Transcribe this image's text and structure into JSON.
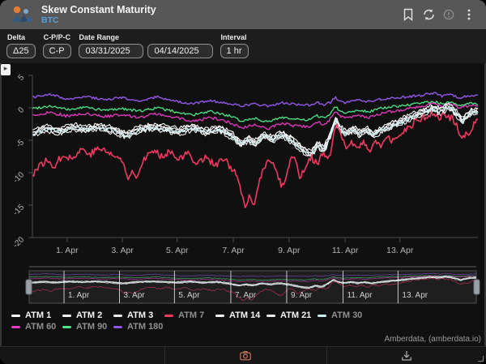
{
  "header": {
    "title": "Skew Constant Maturity",
    "subtitle": "BTC",
    "icons": [
      "bookmark",
      "refresh",
      "info",
      "kebab-menu"
    ]
  },
  "controls": {
    "delta": {
      "label": "Delta",
      "value": "Δ25"
    },
    "cppc": {
      "label": "C-P/P-C",
      "value": "C-P"
    },
    "date_range": {
      "label": "Date Range",
      "start": "03/31/2025",
      "end": "04/14/2025"
    },
    "interval": {
      "label": "Interval",
      "value": "1 hr"
    }
  },
  "footer": {
    "attribution": "Amberdata, (amberdata.io)",
    "toolbar_icons": [
      "camera",
      "download"
    ]
  },
  "chart_data": {
    "type": "line",
    "title": "Skew Constant Maturity",
    "xlabel": "",
    "ylabel": "",
    "ylim": [
      -20,
      5
    ],
    "grid": false,
    "legend_position": "bottom",
    "y_ticks": [
      {
        "label": "5",
        "value": 5
      },
      {
        "label": "0",
        "value": 0
      },
      {
        "label": "-5",
        "value": -5
      },
      {
        "label": "-10",
        "value": -10
      },
      {
        "label": "-15",
        "value": -15
      },
      {
        "label": "-20",
        "value": -20
      }
    ],
    "x_ticks": [
      {
        "label": "1. Apr",
        "frac": 0.078
      },
      {
        "label": "3. Apr",
        "frac": 0.202
      },
      {
        "label": "5. Apr",
        "frac": 0.325
      },
      {
        "label": "7. Apr",
        "frac": 0.451
      },
      {
        "label": "9. Apr",
        "frac": 0.576
      },
      {
        "label": "11. Apr",
        "frac": 0.702
      },
      {
        "label": "13. Apr",
        "frac": 0.825
      }
    ],
    "navigator": {
      "vmin": -17,
      "vmax": 4,
      "labels": [
        "1. Apr",
        "3. Apr",
        "5. Apr",
        "7. Apr",
        "9. Apr",
        "11. Apr",
        "13. Apr"
      ]
    },
    "draw_order": [
      "ATM 180",
      "ATM 90",
      "ATM 60",
      "ATM 21",
      "ATM 14",
      "ATM 3",
      "ATM 2",
      "ATM 1",
      "ATM 30",
      "ATM 7"
    ],
    "series": [
      {
        "name": "ATM 1",
        "color": "#ffffff",
        "dim": false,
        "width": 1.1,
        "noise": 0.28,
        "seed": 11,
        "base": "ATM 30",
        "offset": 0.55
      },
      {
        "name": "ATM 2",
        "color": "#f4f4f4",
        "dim": false,
        "width": 1.1,
        "noise": 0.3,
        "seed": 22,
        "base": "ATM 30",
        "offset": 0.3
      },
      {
        "name": "ATM 3",
        "color": "#ededed",
        "dim": false,
        "width": 1.1,
        "noise": 0.3,
        "seed": 33,
        "base": "ATM 30",
        "offset": 0.1
      },
      {
        "name": "ATM 7",
        "color": "#ef3a62",
        "dim": true,
        "width": 1.6,
        "noise": 0.55,
        "seed": 77,
        "points": [
          [
            0,
            -10.3
          ],
          [
            0.012,
            -9.2
          ],
          [
            0.03,
            -8.2
          ],
          [
            0.05,
            -8.9
          ],
          [
            0.07,
            -7.1
          ],
          [
            0.09,
            -7.9
          ],
          [
            0.11,
            -6.3
          ],
          [
            0.13,
            -7.1
          ],
          [
            0.15,
            -6.2
          ],
          [
            0.17,
            -6.9
          ],
          [
            0.19,
            -7.6
          ],
          [
            0.205,
            -8.6
          ],
          [
            0.215,
            -11.2
          ],
          [
            0.225,
            -9.4
          ],
          [
            0.235,
            -10.6
          ],
          [
            0.25,
            -7.8
          ],
          [
            0.27,
            -6.7
          ],
          [
            0.29,
            -7.4
          ],
          [
            0.31,
            -6.6
          ],
          [
            0.33,
            -7.9
          ],
          [
            0.35,
            -7
          ],
          [
            0.37,
            -8.6
          ],
          [
            0.39,
            -7.5
          ],
          [
            0.41,
            -8.9
          ],
          [
            0.43,
            -7.9
          ],
          [
            0.45,
            -9.5
          ],
          [
            0.462,
            -11
          ],
          [
            0.472,
            -14.2
          ],
          [
            0.478,
            -15.9
          ],
          [
            0.487,
            -13.2
          ],
          [
            0.497,
            -15.7
          ],
          [
            0.507,
            -11.8
          ],
          [
            0.52,
            -9
          ],
          [
            0.532,
            -8.1
          ],
          [
            0.545,
            -9.2
          ],
          [
            0.56,
            -12.4
          ],
          [
            0.572,
            -9.8
          ],
          [
            0.582,
            -7.3
          ],
          [
            0.592,
            -8.4
          ],
          [
            0.602,
            -10.9
          ],
          [
            0.612,
            -9
          ],
          [
            0.625,
            -7.5
          ],
          [
            0.64,
            -8.8
          ],
          [
            0.652,
            -7
          ],
          [
            0.665,
            -8.2
          ],
          [
            0.675,
            -4.6
          ],
          [
            0.683,
            -2.6
          ],
          [
            0.692,
            -4.3
          ],
          [
            0.703,
            -6.2
          ],
          [
            0.715,
            -4.9
          ],
          [
            0.728,
            -6.4
          ],
          [
            0.742,
            -5.3
          ],
          [
            0.756,
            -6.6
          ],
          [
            0.77,
            -5
          ],
          [
            0.784,
            -5.9
          ],
          [
            0.798,
            -4.6
          ],
          [
            0.812,
            -5.4
          ],
          [
            0.826,
            -4
          ],
          [
            0.845,
            -3
          ],
          [
            0.865,
            -1.9
          ],
          [
            0.885,
            -1.3
          ],
          [
            0.9,
            -0.9
          ],
          [
            0.912,
            -1.7
          ],
          [
            0.925,
            -1
          ],
          [
            0.94,
            -1.6
          ],
          [
            0.952,
            -2.6
          ],
          [
            0.963,
            -4.9
          ],
          [
            0.972,
            -3.9
          ],
          [
            0.981,
            -4.6
          ],
          [
            0.991,
            -2.6
          ],
          [
            1,
            -2.1
          ]
        ]
      },
      {
        "name": "ATM 14",
        "color": "#fbfbfb",
        "dim": false,
        "width": 1.1,
        "noise": 0.3,
        "seed": 44,
        "base": "ATM 30",
        "offset": -0.15
      },
      {
        "name": "ATM 21",
        "color": "#f0f0f0",
        "dim": false,
        "width": 1.1,
        "noise": 0.32,
        "seed": 55,
        "base": "ATM 30",
        "offset": -0.35
      },
      {
        "name": "ATM 30",
        "color": "#c9eef0",
        "dim": true,
        "width": 1.2,
        "noise": 0.3,
        "seed": 66,
        "points": [
          [
            0,
            -4
          ],
          [
            0.03,
            -3.2
          ],
          [
            0.06,
            -3.7
          ],
          [
            0.09,
            -3
          ],
          [
            0.12,
            -3.4
          ],
          [
            0.15,
            -3
          ],
          [
            0.18,
            -3.5
          ],
          [
            0.21,
            -4.3
          ],
          [
            0.24,
            -3.4
          ],
          [
            0.27,
            -3
          ],
          [
            0.3,
            -3.3
          ],
          [
            0.33,
            -3.7
          ],
          [
            0.36,
            -3.1
          ],
          [
            0.39,
            -3.8
          ],
          [
            0.42,
            -3.3
          ],
          [
            0.45,
            -4.5
          ],
          [
            0.468,
            -5.6
          ],
          [
            0.485,
            -4.9
          ],
          [
            0.5,
            -5.5
          ],
          [
            0.52,
            -4.3
          ],
          [
            0.54,
            -4.9
          ],
          [
            0.56,
            -4.1
          ],
          [
            0.585,
            -5.2
          ],
          [
            0.605,
            -6.4
          ],
          [
            0.625,
            -7.3
          ],
          [
            0.64,
            -5.8
          ],
          [
            0.655,
            -6.6
          ],
          [
            0.668,
            -4.4
          ],
          [
            0.68,
            -1.9
          ],
          [
            0.69,
            -3.3
          ],
          [
            0.705,
            -4
          ],
          [
            0.72,
            -3.3
          ],
          [
            0.735,
            -4.1
          ],
          [
            0.75,
            -3.5
          ],
          [
            0.765,
            -4.2
          ],
          [
            0.78,
            -3.6
          ],
          [
            0.8,
            -3
          ],
          [
            0.82,
            -2.4
          ],
          [
            0.84,
            -1.8
          ],
          [
            0.86,
            -1.2
          ],
          [
            0.88,
            -0.7
          ],
          [
            0.9,
            -0.1
          ],
          [
            0.915,
            -0.6
          ],
          [
            0.93,
            0
          ],
          [
            0.945,
            -0.4
          ],
          [
            0.955,
            -1.2
          ],
          [
            0.965,
            -2.1
          ],
          [
            0.975,
            -1.3
          ],
          [
            0.985,
            -0.8
          ],
          [
            1,
            -0.5
          ]
        ]
      },
      {
        "name": "ATM 60",
        "color": "#e63cc0",
        "dim": true,
        "width": 1.3,
        "noise": 0.22,
        "seed": 88,
        "points": [
          [
            0,
            -1.2
          ],
          [
            0.04,
            -0.7
          ],
          [
            0.08,
            -1.3
          ],
          [
            0.12,
            -0.9
          ],
          [
            0.16,
            -1.4
          ],
          [
            0.2,
            -1
          ],
          [
            0.24,
            -1.5
          ],
          [
            0.28,
            -0.9
          ],
          [
            0.32,
            -1.5
          ],
          [
            0.36,
            -2.1
          ],
          [
            0.4,
            -1.5
          ],
          [
            0.44,
            -2.2
          ],
          [
            0.468,
            -3.1
          ],
          [
            0.5,
            -2.6
          ],
          [
            0.53,
            -3.2
          ],
          [
            0.56,
            -2.4
          ],
          [
            0.59,
            -2.8
          ],
          [
            0.62,
            -2.9
          ],
          [
            0.64,
            -2.2
          ],
          [
            0.655,
            -2.6
          ],
          [
            0.668,
            -1.8
          ],
          [
            0.68,
            -0.4
          ],
          [
            0.69,
            -1.3
          ],
          [
            0.705,
            -1.6
          ],
          [
            0.73,
            -1.1
          ],
          [
            0.755,
            -1.5
          ],
          [
            0.78,
            -0.9
          ],
          [
            0.81,
            -0.5
          ],
          [
            0.84,
            -0.2
          ],
          [
            0.87,
            0.2
          ],
          [
            0.9,
            0.7
          ],
          [
            0.92,
            0.3
          ],
          [
            0.94,
            0.6
          ],
          [
            0.957,
            -0.1
          ],
          [
            0.97,
            0.2
          ],
          [
            0.985,
            0.4
          ],
          [
            1,
            0.3
          ]
        ]
      },
      {
        "name": "ATM 90",
        "color": "#4ee488",
        "dim": true,
        "width": 1.3,
        "noise": 0.2,
        "seed": 99,
        "points": [
          [
            0,
            -0.1
          ],
          [
            0.04,
            0.3
          ],
          [
            0.08,
            -0.3
          ],
          [
            0.12,
            0.1
          ],
          [
            0.16,
            -0.4
          ],
          [
            0.2,
            -0.1
          ],
          [
            0.24,
            -0.5
          ],
          [
            0.28,
            0
          ],
          [
            0.32,
            -0.6
          ],
          [
            0.36,
            -1.1
          ],
          [
            0.4,
            -0.6
          ],
          [
            0.44,
            -1.2
          ],
          [
            0.468,
            -2
          ],
          [
            0.5,
            -1.6
          ],
          [
            0.53,
            -2.2
          ],
          [
            0.56,
            -1.4
          ],
          [
            0.59,
            -1.8
          ],
          [
            0.62,
            -1.9
          ],
          [
            0.64,
            -1.2
          ],
          [
            0.655,
            -1.6
          ],
          [
            0.668,
            -0.9
          ],
          [
            0.68,
            0.3
          ],
          [
            0.69,
            -0.5
          ],
          [
            0.705,
            -0.8
          ],
          [
            0.73,
            -0.3
          ],
          [
            0.755,
            -0.6
          ],
          [
            0.78,
            -0.1
          ],
          [
            0.81,
            0.2
          ],
          [
            0.84,
            0.4
          ],
          [
            0.87,
            0.7
          ],
          [
            0.9,
            1
          ],
          [
            0.92,
            0.6
          ],
          [
            0.94,
            0.9
          ],
          [
            0.957,
            0.2
          ],
          [
            0.97,
            0.5
          ],
          [
            0.985,
            0.7
          ],
          [
            1,
            0.6
          ]
        ]
      },
      {
        "name": "ATM 180",
        "color": "#9257e6",
        "dim": true,
        "width": 1.4,
        "noise": 0.18,
        "seed": 111,
        "points": [
          [
            0,
            1.6
          ],
          [
            0.04,
            2.1
          ],
          [
            0.08,
            1.3
          ],
          [
            0.12,
            1.8
          ],
          [
            0.16,
            1.2
          ],
          [
            0.2,
            1.6
          ],
          [
            0.24,
            1.1
          ],
          [
            0.28,
            1.7
          ],
          [
            0.32,
            1
          ],
          [
            0.36,
            0.6
          ],
          [
            0.4,
            1.1
          ],
          [
            0.44,
            0.7
          ],
          [
            0.468,
            0.3
          ],
          [
            0.5,
            0.6
          ],
          [
            0.53,
            0.2
          ],
          [
            0.56,
            0.8
          ],
          [
            0.59,
            0.5
          ],
          [
            0.62,
            0.4
          ],
          [
            0.64,
            0.8
          ],
          [
            0.655,
            0.5
          ],
          [
            0.668,
            0.8
          ],
          [
            0.68,
            1.6
          ],
          [
            0.69,
            0.9
          ],
          [
            0.705,
            0.8
          ],
          [
            0.73,
            1.2
          ],
          [
            0.755,
            1
          ],
          [
            0.78,
            1.3
          ],
          [
            0.81,
            1.5
          ],
          [
            0.84,
            1.7
          ],
          [
            0.87,
            1.9
          ],
          [
            0.9,
            2.3
          ],
          [
            0.92,
            1.8
          ],
          [
            0.94,
            2.1
          ],
          [
            0.957,
            1.5
          ],
          [
            0.97,
            1.7
          ],
          [
            0.985,
            1.9
          ],
          [
            1,
            1.8
          ]
        ]
      }
    ]
  }
}
